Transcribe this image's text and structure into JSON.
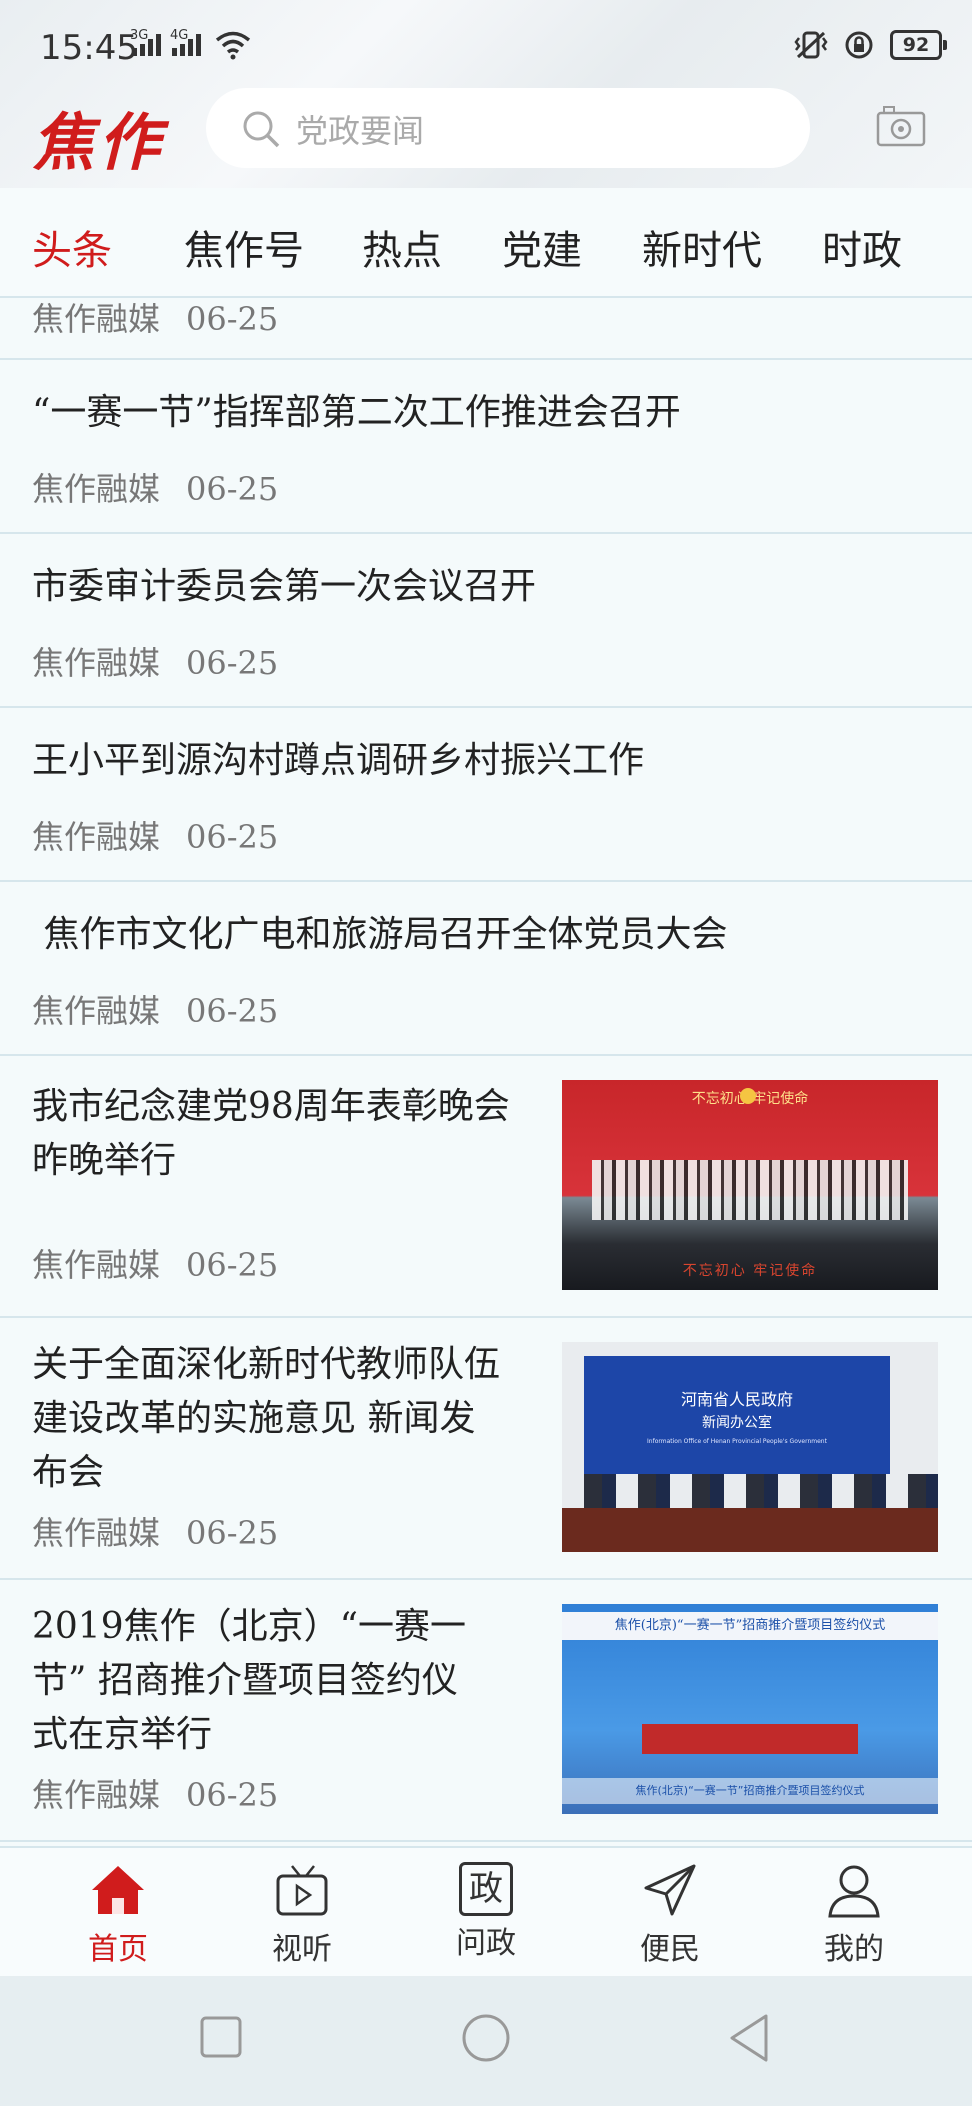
{
  "status_bar": {
    "time": "15:45",
    "net1": "3G",
    "net2": "4G",
    "battery": "92"
  },
  "header": {
    "logo": "焦作",
    "search_placeholder": "党政要闻"
  },
  "tabs": [
    {
      "label": "头条",
      "active": true
    },
    {
      "label": "焦作号"
    },
    {
      "label": "热点"
    },
    {
      "label": "党建"
    },
    {
      "label": "新时代"
    },
    {
      "label": "时政"
    }
  ],
  "feed": {
    "partial_item": {
      "source": "焦作融媒",
      "date": "06-25"
    },
    "items": [
      {
        "title": "“一赛一节”指挥部第二次工作推进会召开",
        "source": "焦作融媒",
        "date": "06-25"
      },
      {
        "title": "市委审计委员会第一次会议召开",
        "source": "焦作融媒",
        "date": "06-25"
      },
      {
        "title": "王小平到源沟村蹲点调研乡村振兴工作",
        "source": "焦作融媒",
        "date": "06-25"
      },
      {
        "title": " 焦作市文化广电和旅游局召开全体党员大会",
        "source": "焦作融媒",
        "date": "06-25"
      },
      {
        "title_lines": [
          "我市纪念建党98周年表彰晚会",
          "昨晚举行"
        ],
        "source": "焦作融媒",
        "date": "06-25",
        "image": {
          "banner_text": "不忘初心 牢记使命",
          "bottom_text": "不忘初心 牢记使命"
        }
      },
      {
        "title_lines": [
          "关于全面深化新时代教师队伍",
          "建设改革的实施意见 新闻发",
          "布会"
        ],
        "source": "焦作融媒",
        "date": "06-25",
        "image": {
          "line1": "河南省人民政府",
          "line2": "新闻办公室",
          "line3": "Information Office of Henan Provincial People's Government"
        }
      },
      {
        "title_lines": [
          "2019焦作（北京）“一赛一",
          "节” 招商推介暨项目签约仪",
          "式在京举行"
        ],
        "source": "焦作融媒",
        "date": "06-25",
        "image": {
          "banner_text": "焦作(北京)“一赛一节”招商推介暨项目签约仪式",
          "bottom_text": "焦作(北京)“一赛一节”招商推介暨项目签约仪式"
        }
      }
    ]
  },
  "bottom_nav": [
    {
      "label": "首页",
      "icon": "home-icon",
      "active": true
    },
    {
      "label": "视听",
      "icon": "tv-icon"
    },
    {
      "label": "问政",
      "icon": "politics-icon",
      "glyph": "政"
    },
    {
      "label": "便民",
      "icon": "send-icon"
    },
    {
      "label": "我的",
      "icon": "user-icon"
    }
  ],
  "colors": {
    "accent": "#d01c1c",
    "background": "#f4fafb"
  }
}
